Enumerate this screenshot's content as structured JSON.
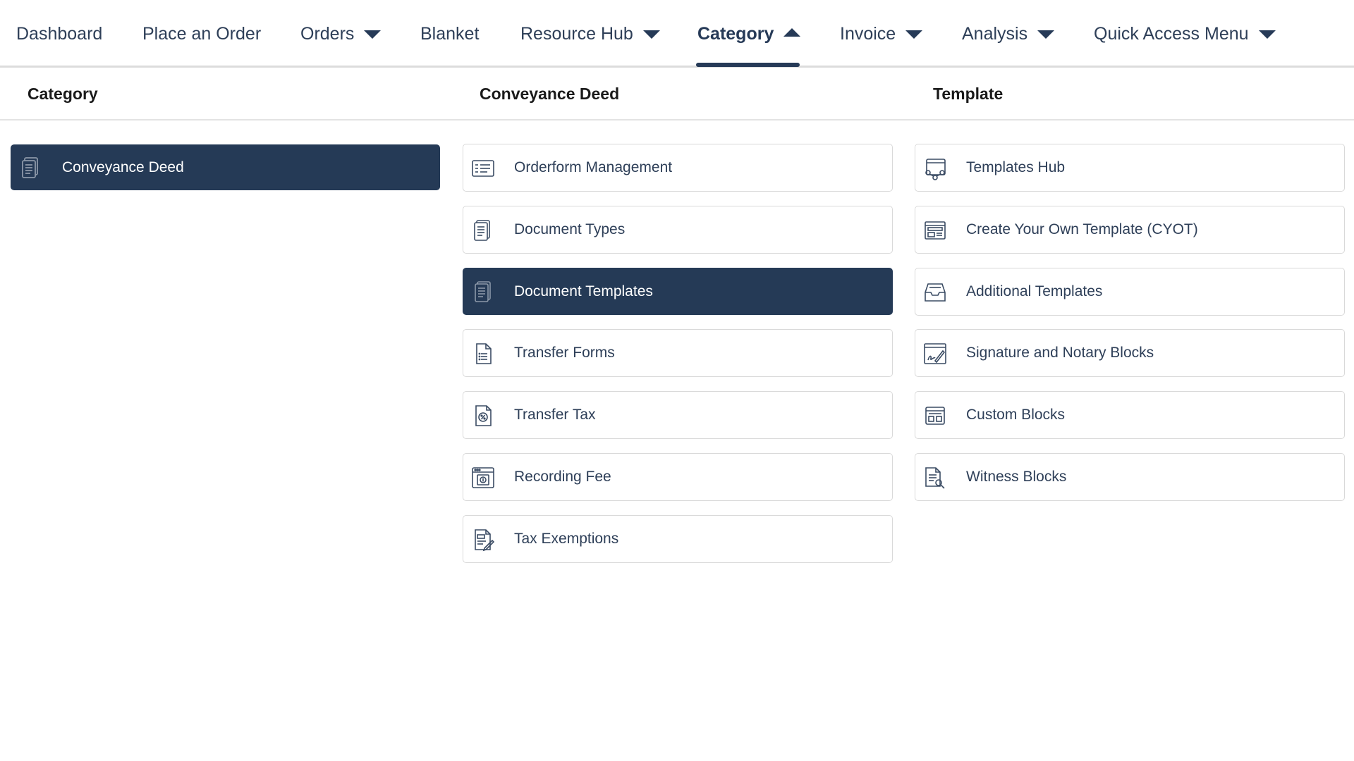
{
  "nav": {
    "items": [
      {
        "label": "Dashboard",
        "dropdown": false,
        "active": false
      },
      {
        "label": "Place an Order",
        "dropdown": false,
        "active": false
      },
      {
        "label": "Orders",
        "dropdown": true,
        "active": false
      },
      {
        "label": "Blanket",
        "dropdown": false,
        "active": false
      },
      {
        "label": "Resource Hub",
        "dropdown": true,
        "active": false
      },
      {
        "label": "Category",
        "dropdown": true,
        "active": true
      },
      {
        "label": "Invoice",
        "dropdown": true,
        "active": false
      },
      {
        "label": "Analysis",
        "dropdown": true,
        "active": false
      },
      {
        "label": "Quick Access Menu",
        "dropdown": true,
        "active": false
      }
    ]
  },
  "columns": {
    "category": {
      "header": "Category",
      "items": [
        {
          "label": "Conveyance Deed",
          "icon": "document-stack-icon",
          "selected": true
        }
      ]
    },
    "conveyance": {
      "header": "Conveyance Deed",
      "items": [
        {
          "label": "Orderform Management",
          "icon": "form-list-icon",
          "selected": false
        },
        {
          "label": "Document Types",
          "icon": "documents-icon",
          "selected": false
        },
        {
          "label": "Document Templates",
          "icon": "document-stack-icon",
          "selected": true
        },
        {
          "label": "Transfer Forms",
          "icon": "file-lines-icon",
          "selected": false
        },
        {
          "label": "Transfer Tax",
          "icon": "tax-document-icon",
          "selected": false
        },
        {
          "label": "Recording Fee",
          "icon": "fee-browser-icon",
          "selected": false
        },
        {
          "label": "Tax Exemptions",
          "icon": "tax-exemption-icon",
          "selected": false
        }
      ]
    },
    "template": {
      "header": "Template",
      "items": [
        {
          "label": "Templates Hub",
          "icon": "template-hub-icon",
          "selected": false
        },
        {
          "label": "Create Your Own Template (CYOT)",
          "icon": "layout-builder-icon",
          "selected": false
        },
        {
          "label": "Additional Templates",
          "icon": "tray-icon",
          "selected": false
        },
        {
          "label": "Signature and Notary Blocks",
          "icon": "signature-icon",
          "selected": false
        },
        {
          "label": "Custom Blocks",
          "icon": "blocks-window-icon",
          "selected": false
        },
        {
          "label": "Witness Blocks",
          "icon": "witness-document-icon",
          "selected": false
        }
      ]
    }
  },
  "colors": {
    "accent": "#253a56",
    "nav_text": "#2e3f58",
    "border": "#d9d9d9"
  }
}
